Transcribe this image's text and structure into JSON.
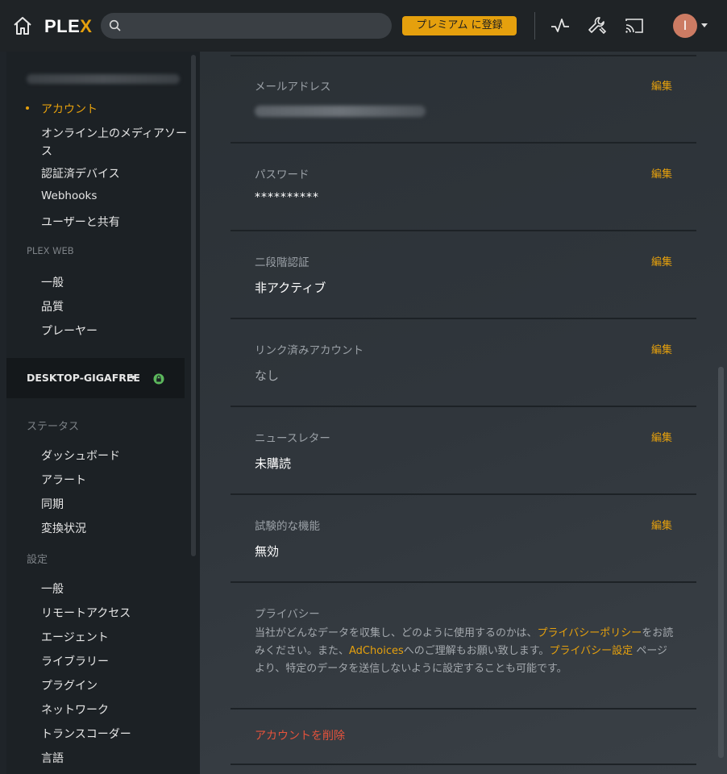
{
  "topbar": {
    "logo_text": "PLE",
    "logo_x": "X",
    "search_placeholder": "",
    "premium_label": "プレミアム に登録",
    "avatar_initial": "I"
  },
  "sidebar": {
    "account_items": [
      {
        "label": "アカウント",
        "active": true
      },
      {
        "label": "オンライン上のメディアソー"
      },
      {
        "label": "ス"
      },
      {
        "label": "認証済デバイス"
      },
      {
        "label": "Webhooks"
      },
      {
        "label": "ユーザーと共有"
      }
    ],
    "plex_web_heading": "PLEX WEB",
    "plex_web_items": [
      "一般",
      "品質",
      "プレーヤー"
    ],
    "server_name": "DESKTOP-GIGAFREE",
    "status_heading": "ステータス",
    "status_items": [
      "ダッシュボード",
      "アラート",
      "同期",
      "変換状況"
    ],
    "settings_heading": "設定",
    "settings_items": [
      "一般",
      "リモートアクセス",
      "エージェント",
      "ライブラリー",
      "プラグイン",
      "ネットワーク",
      "トランスコーダー",
      "言語"
    ]
  },
  "main": {
    "edit_label": "編集",
    "sections": [
      {
        "label": "メールアドレス",
        "value": ""
      },
      {
        "label": "パスワード",
        "value": "**********"
      },
      {
        "label": "二段階認証",
        "value": "非アクティブ"
      },
      {
        "label": "リンク済みアカウント",
        "value": "なし"
      },
      {
        "label": "ニュースレター",
        "value": "未購読"
      },
      {
        "label": "試験的な機能",
        "value": "無効"
      }
    ],
    "privacy": {
      "label": "プライバシー",
      "text_1": "当社がどんなデータを収集し、どのように使用するのかは、",
      "link_1": "プライバシーポリシー",
      "text_2": "をお読みください。また、",
      "link_2": "AdChoices",
      "text_3": "へのご理解もお願い致します。",
      "link_3": "プライバシー設定",
      "text_4": " ページより、特定のデータを送信しないように設定することも可能です。"
    },
    "delete_account": "アカウントを削除"
  },
  "colors": {
    "accent": "#e5a00d",
    "danger": "#e5533c",
    "avatar": "#cc7b63"
  }
}
